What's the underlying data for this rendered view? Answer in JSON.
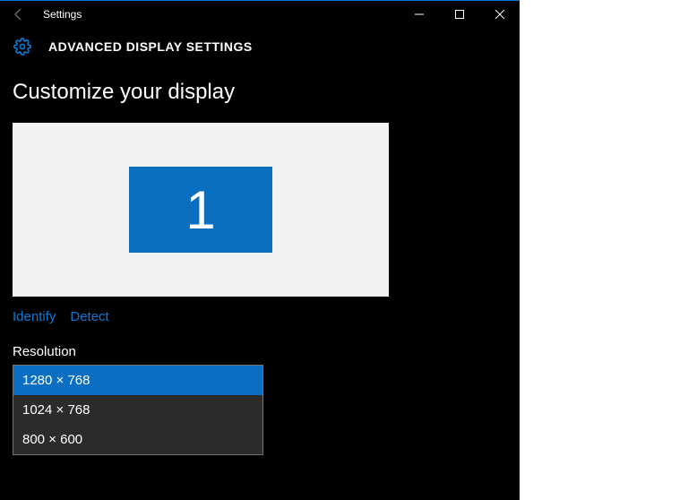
{
  "window": {
    "title": "Settings"
  },
  "header": {
    "title": "ADVANCED DISPLAY SETTINGS"
  },
  "section": {
    "title": "Customize your display"
  },
  "display": {
    "monitor_number": "1"
  },
  "links": {
    "identify": "Identify",
    "detect": "Detect"
  },
  "resolution": {
    "label": "Resolution",
    "options": [
      "1280 × 768",
      "1024 × 768",
      "800 × 600"
    ],
    "selected": "1280 × 768"
  }
}
